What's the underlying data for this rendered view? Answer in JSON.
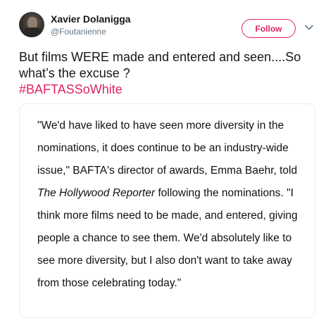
{
  "user": {
    "display_name": "Xavier Dolanigga",
    "handle": "@Foutanienne"
  },
  "actions": {
    "follow_label": "Follow"
  },
  "tweet": {
    "text": "But films WERE made and entered and seen....So what’s the excuse ?",
    "hashtag": "#BAFTASSoWhite"
  },
  "quote": {
    "part1": "\"We'd have liked to have seen more diversity in the nominations, it does continue to be an industry-wide issue,\" BAFTA's director of awards, Emma Baehr, told ",
    "publication": "The Hollywood Reporter",
    "part2": " following the nominations. \"I think more films need to be made, and entered, giving people a chance to see them. We'd absolutely like to see more diversity, but I also don't want to take away from those celebrating today.\""
  },
  "colors": {
    "accent": "#e0245e",
    "handle_gray": "#657786",
    "text": "#14171a",
    "card_border": "#e6ecf0"
  },
  "icons": {
    "menu": "chevron-down-icon",
    "avatar": "user-avatar"
  }
}
